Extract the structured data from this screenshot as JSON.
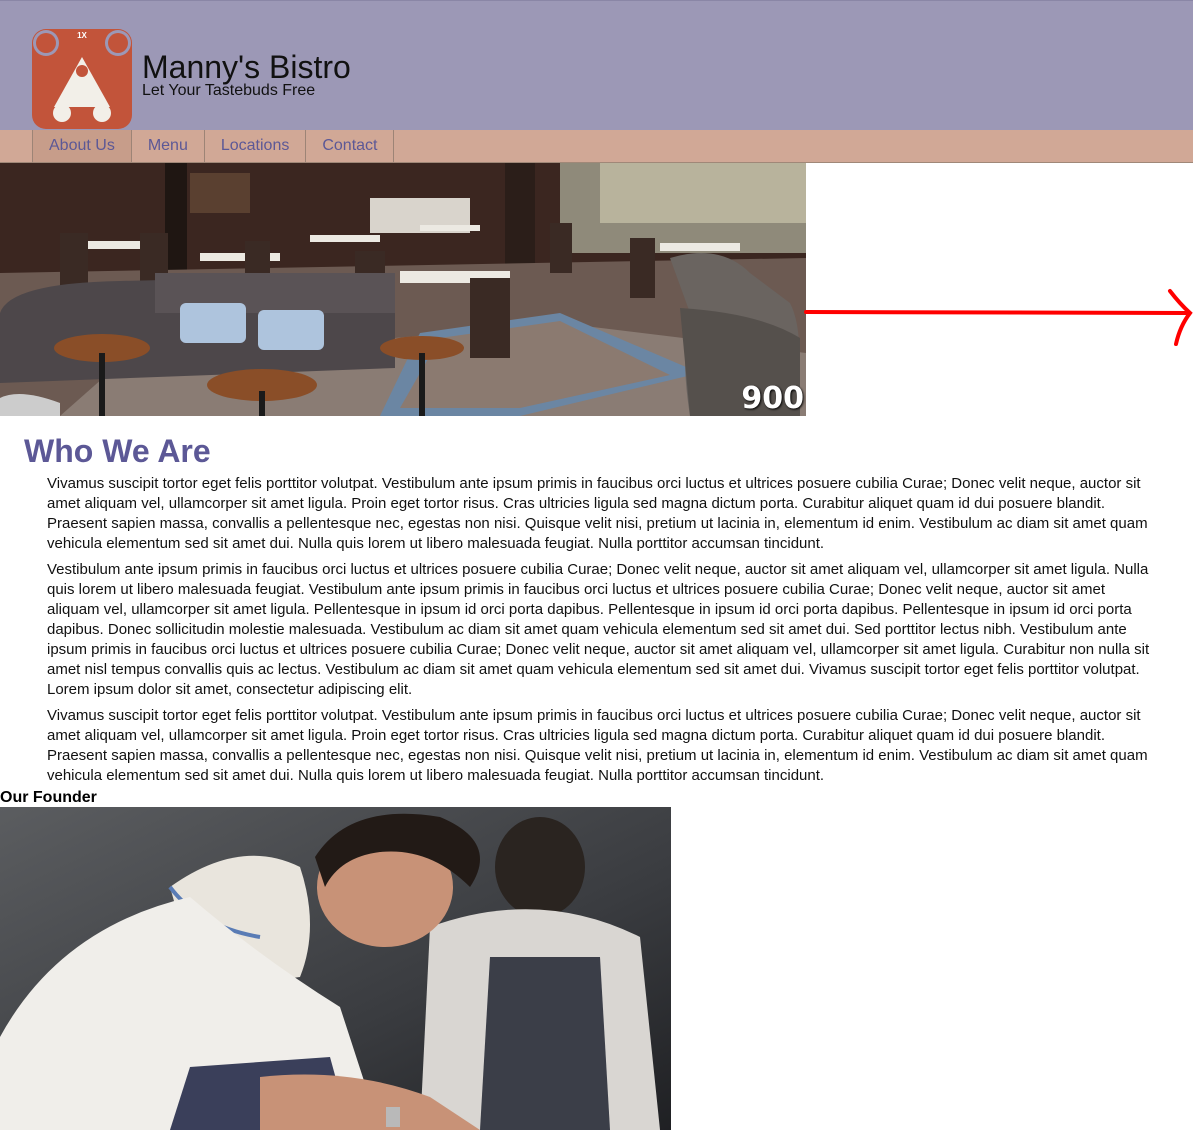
{
  "header": {
    "logo_badge": "1X",
    "brand_name": "Manny's Bistro",
    "tagline": "Let Your Tastebuds Free",
    "logo_color": "#c2543a",
    "background_color": "#9c98b6"
  },
  "nav": {
    "items": [
      {
        "label": "About Us",
        "active": true
      },
      {
        "label": "Menu"
      },
      {
        "label": "Locations"
      },
      {
        "label": "Contact"
      }
    ],
    "background_color": "#d1a896",
    "link_color": "#5c5896"
  },
  "hero": {
    "badge": "900",
    "icon": "restaurant-interior-photo"
  },
  "arrow": {
    "color": "#ff0000",
    "icon": "arrow-right-icon"
  },
  "main": {
    "title": "Who We Are",
    "title_color": "#5c5896",
    "paragraphs": [
      "Vivamus suscipit tortor eget felis porttitor volutpat. Vestibulum ante ipsum primis in faucibus orci luctus et ultrices posuere cubilia Curae; Donec velit neque, auctor sit amet aliquam vel, ullamcorper sit amet ligula. Proin eget tortor risus. Cras ultricies ligula sed magna dictum porta. Curabitur aliquet quam id dui posuere blandit. Praesent sapien massa, convallis a pellentesque nec, egestas non nisi. Quisque velit nisi, pretium ut lacinia in, elementum id enim. Vestibulum ac diam sit amet quam vehicula elementum sed sit amet dui. Nulla quis lorem ut libero malesuada feugiat. Nulla porttitor accumsan tincidunt.",
      "Vestibulum ante ipsum primis in faucibus orci luctus et ultrices posuere cubilia Curae; Donec velit neque, auctor sit amet aliquam vel, ullamcorper sit amet ligula. Nulla quis lorem ut libero malesuada feugiat. Vestibulum ante ipsum primis in faucibus orci luctus et ultrices posuere cubilia Curae; Donec velit neque, auctor sit amet aliquam vel, ullamcorper sit amet ligula. Pellentesque in ipsum id orci porta dapibus. Pellentesque in ipsum id orci porta dapibus. Pellentesque in ipsum id orci porta dapibus. Donec sollicitudin molestie malesuada. Vestibulum ac diam sit amet quam vehicula elementum sed sit amet dui. Sed porttitor lectus nibh. Vestibulum ante ipsum primis in faucibus orci luctus et ultrices posuere cubilia Curae; Donec velit neque, auctor sit amet aliquam vel, ullamcorper sit amet ligula. Curabitur non nulla sit amet nisl tempus convallis quis ac lectus. Vestibulum ac diam sit amet quam vehicula elementum sed sit amet dui. Vivamus suscipit tortor eget felis porttitor volutpat. Lorem ipsum dolor sit amet, consectetur adipiscing elit.",
      "Vivamus suscipit tortor eget felis porttitor volutpat. Vestibulum ante ipsum primis in faucibus orci luctus et ultrices posuere cubilia Curae; Donec velit neque, auctor sit amet aliquam vel, ullamcorper sit amet ligula. Proin eget tortor risus. Cras ultricies ligula sed magna dictum porta. Curabitur aliquet quam id dui posuere blandit. Praesent sapien massa, convallis a pellentesque nec, egestas non nisi. Quisque velit nisi, pretium ut lacinia in, elementum id enim. Vestibulum ac diam sit amet quam vehicula elementum sed sit amet dui. Nulla quis lorem ut libero malesuada feugiat. Nulla porttitor accumsan tincidunt."
    ]
  },
  "founder": {
    "label": "Our Founder",
    "icon": "chef-photo"
  }
}
